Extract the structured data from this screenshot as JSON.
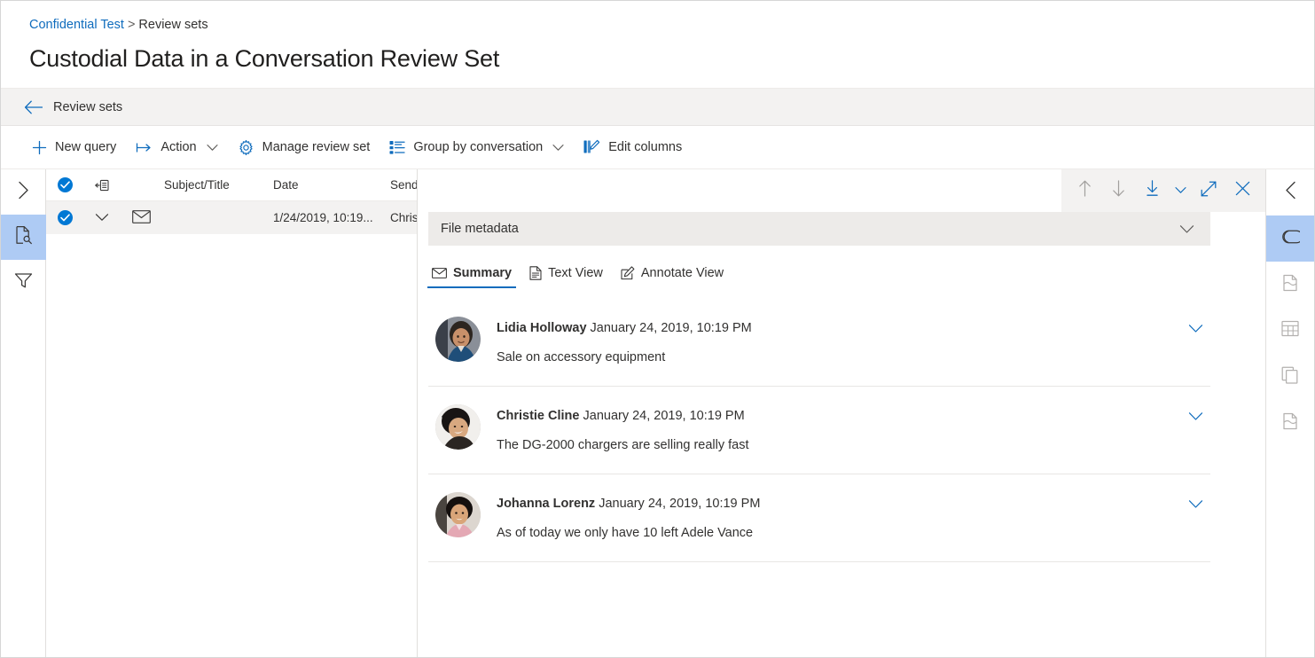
{
  "header": {
    "breadcrumb": {
      "root": "Confidential Test",
      "separator": ">",
      "current": "Review sets"
    },
    "title": "Custodial Data in a Conversation Review Set"
  },
  "backbar": {
    "label": "Review sets",
    "icon": "arrow-left-icon"
  },
  "commandbar": {
    "items": [
      {
        "label": "New query",
        "icon": "plus-icon",
        "chevron": false
      },
      {
        "label": "Action",
        "icon": "action-arrow-icon",
        "chevron": true
      },
      {
        "label": "Manage review set",
        "icon": "gear-icon",
        "chevron": false
      },
      {
        "label": "Group by conversation",
        "icon": "group-list-icon",
        "chevron": true
      },
      {
        "label": "Edit columns",
        "icon": "edit-columns-icon",
        "chevron": false
      }
    ]
  },
  "left_rail": {
    "items": [
      {
        "name": "expand-panel",
        "icon": "chevron-right-icon",
        "state": "normal"
      },
      {
        "name": "search-documents",
        "icon": "file-search-icon",
        "state": "active"
      },
      {
        "name": "filters",
        "icon": "filter-icon",
        "state": "normal"
      }
    ]
  },
  "right_rail": {
    "items": [
      {
        "name": "collapse-panel",
        "icon": "chevron-left-icon",
        "state": "normal"
      },
      {
        "name": "tags",
        "icon": "tag-icon",
        "state": "active"
      },
      {
        "name": "file-metadata",
        "icon": "file-page-icon",
        "state": "dim"
      },
      {
        "name": "table-view",
        "icon": "table-icon",
        "state": "dim"
      },
      {
        "name": "near-duplicates",
        "icon": "copy-icon",
        "state": "dim"
      },
      {
        "name": "document-info",
        "icon": "file-page-icon",
        "state": "dim"
      }
    ]
  },
  "list": {
    "columns": [
      {
        "key": "check",
        "label": "",
        "icon": "select-all-checkbox"
      },
      {
        "key": "expand",
        "label": "",
        "icon": "collapse-rows-icon"
      },
      {
        "key": "type",
        "label": "",
        "icon": ""
      },
      {
        "key": "subject",
        "label": "Subject/Title",
        "icon": ""
      },
      {
        "key": "date",
        "label": "Date",
        "icon": ""
      },
      {
        "key": "sender",
        "label": "Sender",
        "icon": ""
      }
    ],
    "rows": [
      {
        "selected": true,
        "expand_icon": "chevron-down-icon",
        "type_icon": "mail-icon",
        "subject": "",
        "date": "1/24/2019, 10:19...",
        "sender": "Christie"
      }
    ]
  },
  "preview": {
    "toolbar": [
      {
        "name": "previous-item",
        "icon": "arrow-up-icon",
        "state": "disabled"
      },
      {
        "name": "next-item",
        "icon": "arrow-down-icon",
        "state": "disabled"
      },
      {
        "name": "download",
        "icon": "download-icon",
        "state": "enabled"
      },
      {
        "name": "download-menu",
        "icon": "chevron-down-icon",
        "state": "enabled"
      },
      {
        "name": "expand-view",
        "icon": "expand-diagonal-icon",
        "state": "enabled"
      },
      {
        "name": "close",
        "icon": "close-icon",
        "state": "enabled"
      }
    ],
    "metadata_bar": {
      "label": "File metadata",
      "icon": "chevron-down-icon"
    },
    "tabs": [
      {
        "label": "Summary",
        "icon": "mail-icon",
        "active": true
      },
      {
        "label": "Text View",
        "icon": "document-icon",
        "active": false
      },
      {
        "label": "Annotate View",
        "icon": "annotate-icon",
        "active": false
      }
    ],
    "messages": [
      {
        "sender": "Lidia Holloway",
        "timestamp": "January 24, 2019, 10:19 PM",
        "text": "Sale on accessory equipment",
        "avatar_id": "avatar-lidia",
        "chevron": "chevron-down-icon"
      },
      {
        "sender": "Christie Cline",
        "timestamp": "January 24, 2019, 10:19 PM",
        "text": "The DG-2000 chargers are selling really fast",
        "avatar_id": "avatar-christie",
        "chevron": "chevron-down-icon"
      },
      {
        "sender": "Johanna Lorenz",
        "timestamp": "January 24, 2019, 10:19 PM",
        "text": "As of today we only have 10 left Adele Vance",
        "avatar_id": "avatar-johanna",
        "chevron": "chevron-down-icon"
      }
    ]
  },
  "colors": {
    "accent": "#0f6cbd",
    "checkbox": "#0078d4",
    "rail_active": "#aecbf4",
    "row_selected": "#f3f2f1",
    "metabar": "#edebe9",
    "disabled": "#a19f9d"
  }
}
